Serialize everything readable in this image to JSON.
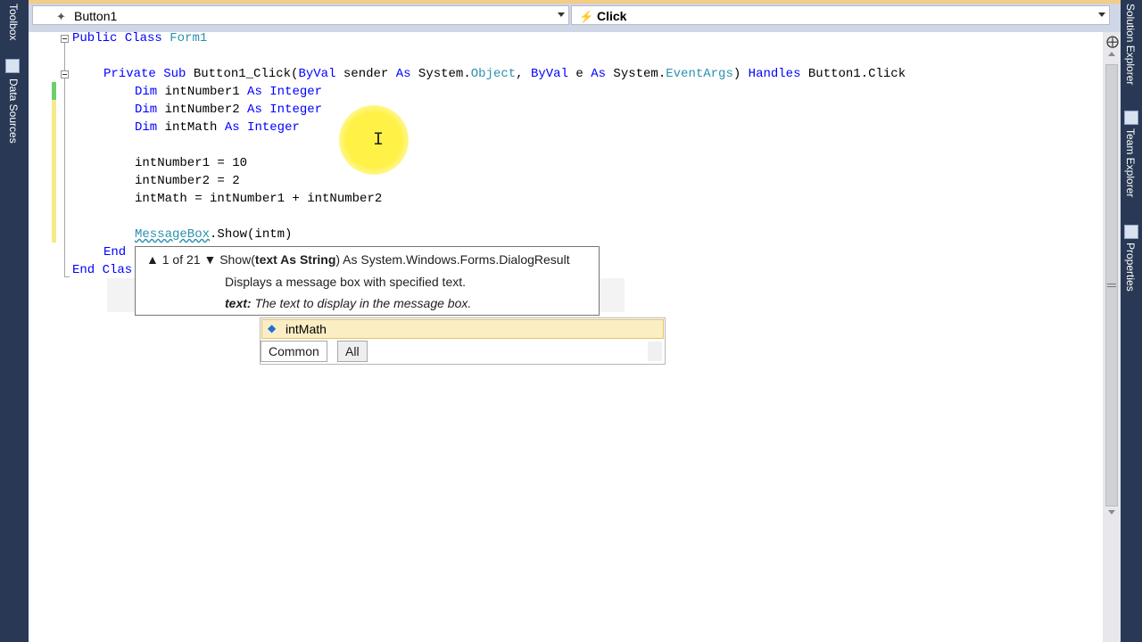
{
  "left_panel": {
    "tabs": [
      {
        "label": "Toolbox",
        "icon": "toolbox-icon"
      },
      {
        "label": "Data Sources",
        "icon": "data-sources-icon"
      }
    ]
  },
  "right_panel": {
    "tabs": [
      {
        "label": "Solution Explorer",
        "icon": "solution-explorer-icon"
      },
      {
        "label": "Team Explorer",
        "icon": "team-explorer-icon"
      },
      {
        "label": "Properties",
        "icon": "properties-icon"
      }
    ]
  },
  "navbar": {
    "object_combo": {
      "value": "Button1",
      "icon": "button-control-icon"
    },
    "event_combo": {
      "value": "Click",
      "icon": "event-lightning-icon"
    }
  },
  "code": {
    "line1": {
      "kw1": "Public",
      "kw2": "Class",
      "name": "Form1"
    },
    "line2": {
      "kw1": "Private",
      "kw2": "Sub",
      "name": " Button1_Click(",
      "kw3": "ByVal",
      "t1": " sender ",
      "kw4": "As",
      "t2": " System.",
      "ty1": "Object",
      "t3": ", ",
      "kw5": "ByVal",
      "t4": " e ",
      "kw6": "As",
      "t5": " System.",
      "ty2": "EventArgs",
      "t6": ") ",
      "kw7": "Handles",
      "t7": " Button1.Click"
    },
    "dim1": {
      "kw": "Dim",
      "name": " intNumber1 ",
      "as": "As",
      "type": " Integer"
    },
    "dim2": {
      "kw": "Dim",
      "name": " intNumber2 ",
      "as": "As",
      "type": " Integer"
    },
    "dim3": {
      "kw": "Dim",
      "name": " intMath ",
      "as": "As",
      "type": " Integer"
    },
    "assign1": "intNumber1 = 10",
    "assign2": "intNumber2 = 2",
    "assign3": "intMath = intNumber1 + intNumber2",
    "msgbox": {
      "cls": "MessageBox",
      "rest": ".Show(intm)"
    },
    "end_sub": "End",
    "end_class": "End Clas"
  },
  "param_info": {
    "counter": "1 of 21",
    "method": "Show(",
    "param_bold": "text As String",
    "signature_rest": ") As System.Windows.Forms.DialogResult",
    "description": "Displays a message box with specified text.",
    "param_name": "text:",
    "param_desc": "The text to display in the message box."
  },
  "completion": {
    "selected_item": "intMath",
    "item_icon": "variable-icon",
    "tabs": [
      "Common",
      "All"
    ]
  }
}
